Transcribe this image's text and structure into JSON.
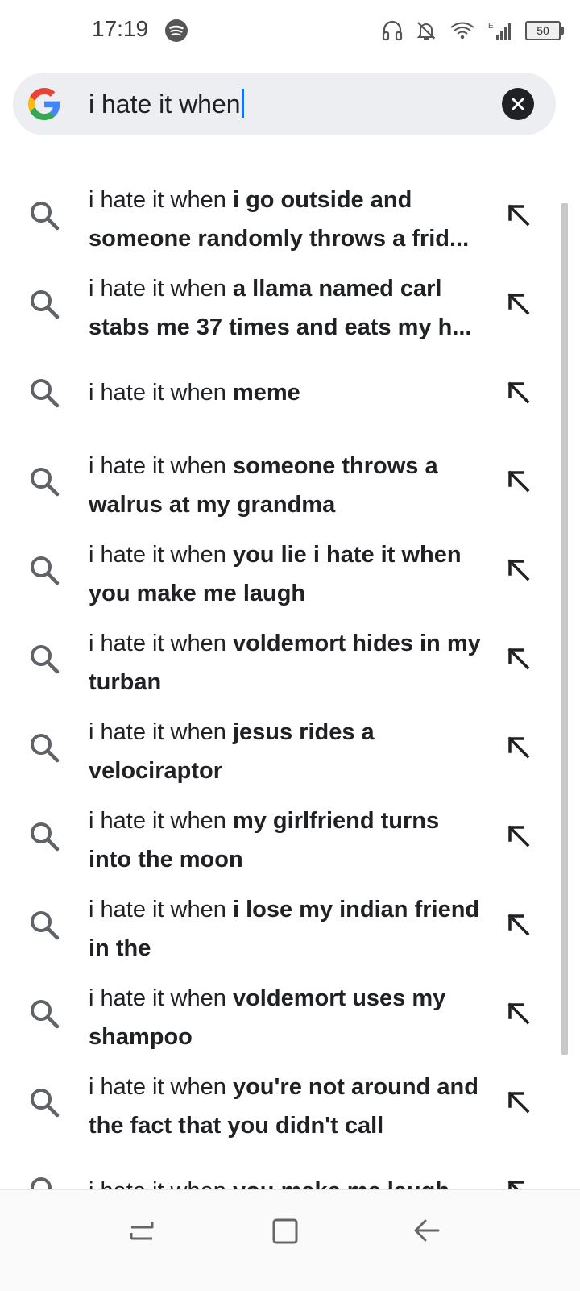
{
  "status_bar": {
    "time": "17:19",
    "battery": "50",
    "icons": [
      "spotify-icon",
      "headphones-icon",
      "bell-off-icon",
      "wifi-icon",
      "signal-icon",
      "battery-icon"
    ]
  },
  "search": {
    "query": "i hate it when",
    "logo": "google-logo",
    "clear_icon": "close-icon"
  },
  "suggestions": [
    {
      "prefix": "i hate it when ",
      "completion": "i go outside and someone randomly throws a frid..."
    },
    {
      "prefix": "i hate it when ",
      "completion": "a llama named carl stabs me 37 times and eats my h..."
    },
    {
      "prefix": "i hate it when ",
      "completion": "meme"
    },
    {
      "prefix": "i hate it when ",
      "completion": "someone throws a walrus at my grandma"
    },
    {
      "prefix": "i hate it when ",
      "completion": "you lie i hate it when you make me laugh"
    },
    {
      "prefix": "i hate it when ",
      "completion": "voldemort hides in my turban"
    },
    {
      "prefix": "i hate it when ",
      "completion": "jesus rides a velociraptor"
    },
    {
      "prefix": "i hate it when ",
      "completion": "my girlfriend turns into the moon"
    },
    {
      "prefix": "i hate it when ",
      "completion": "i lose my indian friend in the"
    },
    {
      "prefix": "i hate it when ",
      "completion": "voldemort uses my shampoo"
    },
    {
      "prefix": "i hate it when ",
      "completion": "you're not around and the fact that you didn't call"
    },
    {
      "prefix": "i hate it when ",
      "completion": "you make me laugh"
    }
  ],
  "nav_bar": {
    "buttons": [
      "recents-icon",
      "home-icon",
      "back-icon"
    ]
  },
  "colors": {
    "search_bg": "#eceef1",
    "caret": "#1a73e8",
    "text": "#202124",
    "icon": "#5f6368"
  }
}
